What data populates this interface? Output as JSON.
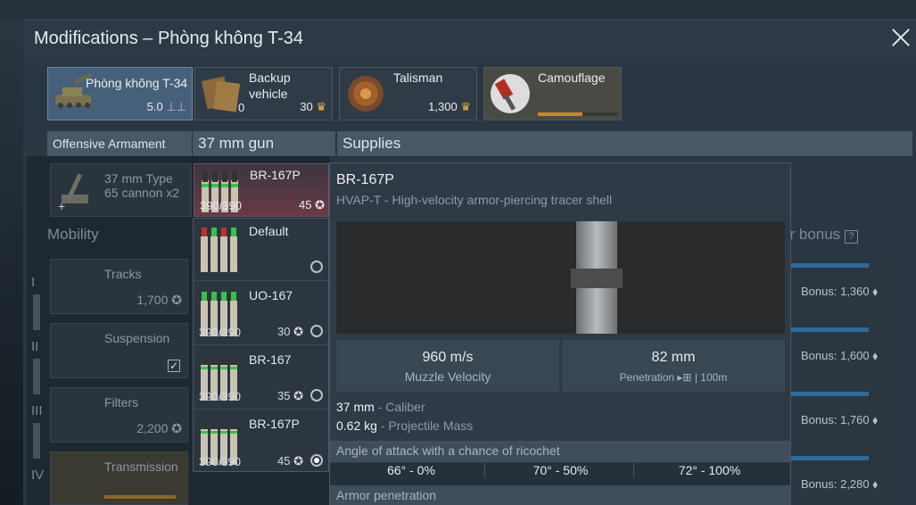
{
  "window": {
    "title": "Modifications – Phòng không T-34"
  },
  "slots": {
    "vehicle": {
      "label": "Phòng không T-34",
      "br": "5.0"
    },
    "backup": {
      "label_line1": "Backup",
      "label_line2": "vehicle",
      "count": "0",
      "price": "30"
    },
    "talisman": {
      "label": "Talisman",
      "price": "1,300"
    },
    "camouflage": {
      "label": "Camouflage",
      "progress": 0.55
    }
  },
  "headers": {
    "offensive": "Offensive Armament",
    "gun": "37 mm gun",
    "supplies": "Supplies"
  },
  "cannon": {
    "label_line1": "37 mm Type",
    "label_line2": "65 cannon x2"
  },
  "selected_ammo": {
    "name": "BR-167P",
    "count": "390/390",
    "price": "45"
  },
  "mobility": {
    "title": "Mobility",
    "tiers": [
      "I",
      "II",
      "III",
      "IV"
    ],
    "items": [
      {
        "name": "Tracks",
        "price": "1,700"
      },
      {
        "name": "Suspension",
        "price": ""
      },
      {
        "name": "Filters",
        "price": "2,200"
      },
      {
        "name": "Transmission",
        "price": ""
      }
    ]
  },
  "ammo_options": [
    {
      "name": "Default",
      "count": "",
      "price": "",
      "selected": false
    },
    {
      "name": "UO-167",
      "count": "390/390",
      "price": "30",
      "selected": false
    },
    {
      "name": "BR-167",
      "count": "390/390",
      "price": "35",
      "selected": false
    },
    {
      "name": "BR-167P",
      "count": "390/390",
      "price": "45",
      "selected": true
    }
  ],
  "bonus": {
    "header": "er bonus",
    "items": [
      "Bonus: 1,360",
      "Bonus: 1,600",
      "Bonus: 1,760",
      "Bonus: 2,280"
    ]
  },
  "tooltip": {
    "name": "BR-167P",
    "desc": "HVAP-T - High-velocity armor-piercing tracer shell",
    "velocity_value": "960 m/s",
    "velocity_label": "Muzzle Velocity",
    "pen_value": "82 mm",
    "pen_label": "Penetration",
    "pen_range": "100m",
    "caliber_value": "37 mm",
    "caliber_label": "Caliber",
    "mass_value": "0.62 kg",
    "mass_label": "Projectile Mass",
    "ricochet_header": "Angle of attack with a chance of ricochet",
    "ricochet": [
      "66° - 0%",
      "70° - 50%",
      "72° - 100%"
    ],
    "armor_header": "Armor penetration"
  },
  "colors": {
    "accent_bonus": "#2c6a9c",
    "selected_ammo_bg": "#6a3a45",
    "camo_progress": "#c9862a"
  }
}
